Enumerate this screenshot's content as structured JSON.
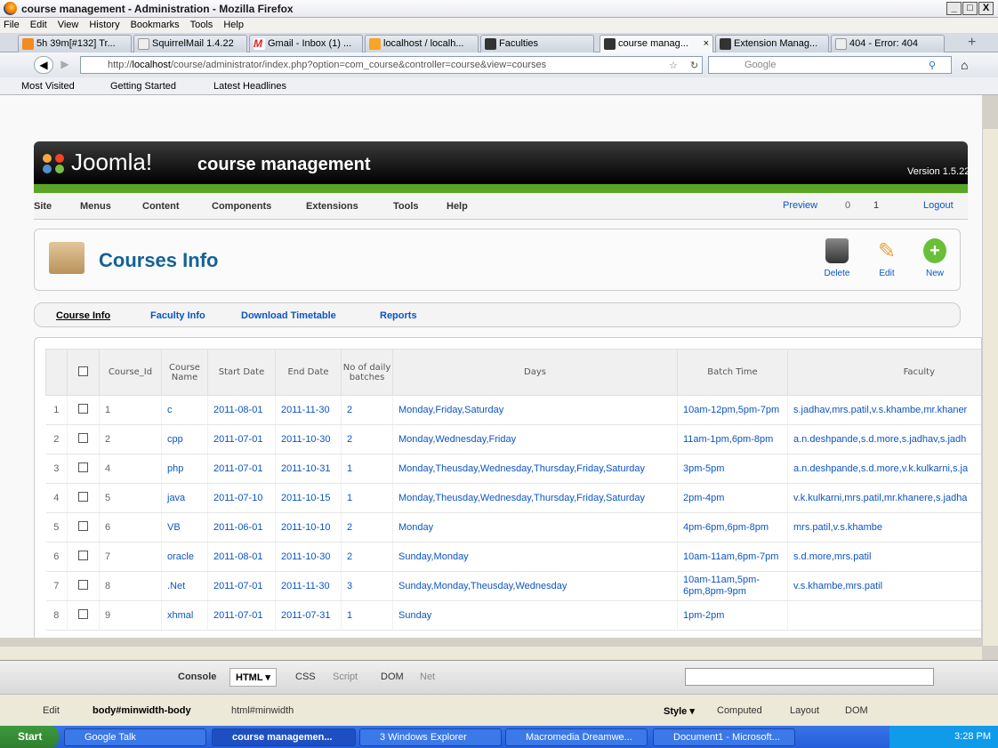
{
  "window": {
    "title": "course management - Administration - Mozilla Firefox",
    "min": "_",
    "max": "□",
    "close": "X"
  },
  "menu": [
    "File",
    "Edit",
    "View",
    "History",
    "Bookmarks",
    "Tools",
    "Help"
  ],
  "tabs": [
    {
      "label": "5h 39m[#132] Tr..."
    },
    {
      "label": "SquirrelMail 1.4.22"
    },
    {
      "label": "Gmail - Inbox (1) ..."
    },
    {
      "label": "localhost / localh..."
    },
    {
      "label": "Faculties"
    },
    {
      "label": "course manag...",
      "active": true
    },
    {
      "label": "Extension Manag..."
    },
    {
      "label": "404 - Error: 404"
    }
  ],
  "url": {
    "prefix": "http://",
    "host": "localhost",
    "path": "/course/administrator/index.php?option=com_course&controller=course&view=courses"
  },
  "search_placeholder": "Google",
  "bookmarks": [
    "Most Visited",
    "Getting Started",
    "Latest Headlines"
  ],
  "joomla": {
    "logo": "Joomla!",
    "site": "course management",
    "version": "Version 1.5.22",
    "menu": [
      "Site",
      "Menus",
      "Content",
      "Components",
      "Extensions",
      "Tools",
      "Help"
    ],
    "right": {
      "preview": "Preview",
      "msgs": "0",
      "users": "1",
      "logout": "Logout"
    }
  },
  "page_title": "Courses Info",
  "toolbar": {
    "delete": "Delete",
    "edit": "Edit",
    "new": "New"
  },
  "subnav": [
    "Course Info",
    "Faculty Info",
    "Download Timetable",
    "Reports"
  ],
  "table": {
    "headers": [
      "Course_Id",
      "Course Name",
      "Start Date",
      "End Date",
      "No of daily batches",
      "Days",
      "Batch Time",
      "Faculty"
    ],
    "rows": [
      [
        "1",
        "1",
        "c",
        "2011-08-01",
        "2011-11-30",
        "2",
        "Monday,Friday,Saturday",
        "10am-12pm,5pm-7pm",
        "s.jadhav,mrs.patil,v.s.khambe,mr.khaner"
      ],
      [
        "2",
        "2",
        "cpp",
        "2011-07-01",
        "2011-10-30",
        "2",
        "Monday,Wednesday,Friday",
        "11am-1pm,6pm-8pm",
        "a.n.deshpande,s.d.more,s.jadhav,s.jadh"
      ],
      [
        "3",
        "4",
        "php",
        "2011-07-01",
        "2011-10-31",
        "1",
        "Monday,Theusday,Wednesday,Thursday,Friday,Saturday",
        "3pm-5pm",
        "a.n.deshpande,s.d.more,v.k.kulkarni,s.ja"
      ],
      [
        "4",
        "5",
        "java",
        "2011-07-10",
        "2011-10-15",
        "1",
        "Monday,Theusday,Wednesday,Thursday,Friday,Saturday",
        "2pm-4pm",
        "v.k.kulkarni,mrs.patil,mr.khanere,s.jadha"
      ],
      [
        "5",
        "6",
        "VB",
        "2011-06-01",
        "2011-10-10",
        "2",
        "Monday",
        "4pm-6pm,6pm-8pm",
        "mrs.patil,v.s.khambe"
      ],
      [
        "6",
        "7",
        "oracle",
        "2011-08-01",
        "2011-10-30",
        "2",
        "Sunday,Monday",
        "10am-11am,6pm-7pm",
        "s.d.more,mrs.patil"
      ],
      [
        "7",
        "8",
        ".Net",
        "2011-07-01",
        "2011-11-30",
        "3",
        "Sunday,Monday,Theusday,Wednesday",
        "10am-11am,5pm-6pm,8pm-9pm",
        "v.s.khambe,mrs.patil"
      ],
      [
        "8",
        "9",
        "xhmal",
        "2011-07-01",
        "2011-07-31",
        "1",
        "Sunday",
        "1pm-2pm",
        ""
      ]
    ]
  },
  "firebug": {
    "tabs": [
      "Console",
      "HTML ▾",
      "CSS",
      "Script",
      "DOM",
      "Net"
    ],
    "path": "body#minwidth-body",
    "path2": "html#minwidth",
    "edit": "Edit",
    "right_tabs": [
      "Style ▾",
      "Computed",
      "Layout",
      "DOM"
    ]
  },
  "taskbar": {
    "start": "Start",
    "items": [
      "Google Talk",
      "course managemen...",
      "3 Windows Explorer",
      "Macromedia Dreamwe...",
      "Document1 - Microsoft..."
    ],
    "time": "3:28 PM"
  }
}
